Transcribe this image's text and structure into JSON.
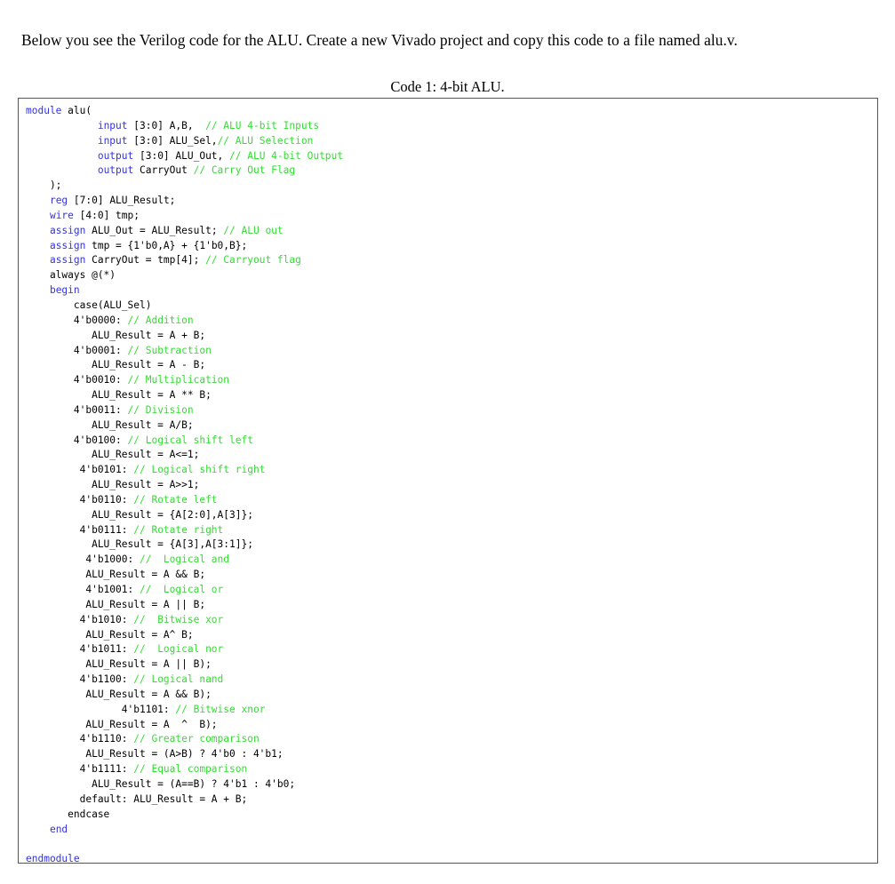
{
  "document": {
    "intro_paragraph": "Below you see the Verilog code for the ALU. Create a new Vivado project and copy this code to a file named alu.v.",
    "caption": "Code 1: 4-bit ALU."
  },
  "colors": {
    "keyword": "#3333dd",
    "comment": "#33dd33",
    "plain": "#000000",
    "box_border": "#555555",
    "background": "#ffffff"
  },
  "code": {
    "language": "verilog",
    "file_name": "alu.v",
    "lines": [
      [
        {
          "t": "module",
          "c": "kw"
        },
        {
          "t": " alu(",
          "c": "pln"
        }
      ],
      [
        {
          "t": "            ",
          "c": "pln"
        },
        {
          "t": "input",
          "c": "kw"
        },
        {
          "t": " [3:0] A,B,  ",
          "c": "pln"
        },
        {
          "t": "// ALU 4-bit Inputs",
          "c": "cmt"
        }
      ],
      [
        {
          "t": "            ",
          "c": "pln"
        },
        {
          "t": "input",
          "c": "kw"
        },
        {
          "t": " [3:0] ALU_Sel,",
          "c": "pln"
        },
        {
          "t": "// ALU Selection",
          "c": "cmt"
        }
      ],
      [
        {
          "t": "            ",
          "c": "pln"
        },
        {
          "t": "output",
          "c": "kw"
        },
        {
          "t": " [3:0] ALU_Out, ",
          "c": "pln"
        },
        {
          "t": "// ALU 4-bit Output",
          "c": "cmt"
        }
      ],
      [
        {
          "t": "            ",
          "c": "pln"
        },
        {
          "t": "output",
          "c": "kw"
        },
        {
          "t": " CarryOut ",
          "c": "pln"
        },
        {
          "t": "// Carry Out Flag",
          "c": "cmt"
        }
      ],
      [
        {
          "t": "    );",
          "c": "pln"
        }
      ],
      [
        {
          "t": "    ",
          "c": "pln"
        },
        {
          "t": "reg",
          "c": "kw"
        },
        {
          "t": " [7:0] ALU_Result;",
          "c": "pln"
        }
      ],
      [
        {
          "t": "    ",
          "c": "pln"
        },
        {
          "t": "wire",
          "c": "kw"
        },
        {
          "t": " [4:0] tmp;",
          "c": "pln"
        }
      ],
      [
        {
          "t": "    ",
          "c": "pln"
        },
        {
          "t": "assign",
          "c": "kw"
        },
        {
          "t": " ALU_Out = ALU_Result; ",
          "c": "pln"
        },
        {
          "t": "// ALU out",
          "c": "cmt"
        }
      ],
      [
        {
          "t": "    ",
          "c": "pln"
        },
        {
          "t": "assign",
          "c": "kw"
        },
        {
          "t": " tmp = {1'b0,A} + {1'b0,B};",
          "c": "pln"
        }
      ],
      [
        {
          "t": "    ",
          "c": "pln"
        },
        {
          "t": "assign",
          "c": "kw"
        },
        {
          "t": " CarryOut = tmp[4]; ",
          "c": "pln"
        },
        {
          "t": "// Carryout flag",
          "c": "cmt"
        }
      ],
      [
        {
          "t": "    always @(*)",
          "c": "pln"
        }
      ],
      [
        {
          "t": "    ",
          "c": "pln"
        },
        {
          "t": "begin",
          "c": "kw"
        }
      ],
      [
        {
          "t": "        case(ALU_Sel)",
          "c": "pln"
        }
      ],
      [
        {
          "t": "        4'b0000: ",
          "c": "pln"
        },
        {
          "t": "// Addition",
          "c": "cmt"
        }
      ],
      [
        {
          "t": "           ALU_Result = A + B;",
          "c": "pln"
        }
      ],
      [
        {
          "t": "        4'b0001: ",
          "c": "pln"
        },
        {
          "t": "// Subtraction",
          "c": "cmt"
        }
      ],
      [
        {
          "t": "           ALU_Result = A - B;",
          "c": "pln"
        }
      ],
      [
        {
          "t": "        4'b0010: ",
          "c": "pln"
        },
        {
          "t": "// Multiplication",
          "c": "cmt"
        }
      ],
      [
        {
          "t": "           ALU_Result = A ** B;",
          "c": "pln"
        }
      ],
      [
        {
          "t": "        4'b0011: ",
          "c": "pln"
        },
        {
          "t": "// Division",
          "c": "cmt"
        }
      ],
      [
        {
          "t": "           ALU_Result = A/B;",
          "c": "pln"
        }
      ],
      [
        {
          "t": "        4'b0100: ",
          "c": "pln"
        },
        {
          "t": "// Logical shift left",
          "c": "cmt"
        }
      ],
      [
        {
          "t": "           ALU_Result = A<=1;",
          "c": "pln"
        }
      ],
      [
        {
          "t": "         4'b0101: ",
          "c": "pln"
        },
        {
          "t": "// Logical shift right",
          "c": "cmt"
        }
      ],
      [
        {
          "t": "           ALU_Result = A>>1;",
          "c": "pln"
        }
      ],
      [
        {
          "t": "         4'b0110: ",
          "c": "pln"
        },
        {
          "t": "// Rotate left",
          "c": "cmt"
        }
      ],
      [
        {
          "t": "           ALU_Result = {A[2:0],A[3]};",
          "c": "pln"
        }
      ],
      [
        {
          "t": "         4'b0111: ",
          "c": "pln"
        },
        {
          "t": "// Rotate right",
          "c": "cmt"
        }
      ],
      [
        {
          "t": "           ALU_Result = {A[3],A[3:1]};",
          "c": "pln"
        }
      ],
      [
        {
          "t": "          4'b1000: ",
          "c": "pln"
        },
        {
          "t": "//  Logical and",
          "c": "cmt"
        }
      ],
      [
        {
          "t": "          ALU_Result = A && B;",
          "c": "pln"
        }
      ],
      [
        {
          "t": "          4'b1001: ",
          "c": "pln"
        },
        {
          "t": "//  Logical or",
          "c": "cmt"
        }
      ],
      [
        {
          "t": "          ALU_Result = A || B;",
          "c": "pln"
        }
      ],
      [
        {
          "t": "         4'b1010: ",
          "c": "pln"
        },
        {
          "t": "//  Bitwise xor",
          "c": "cmt"
        }
      ],
      [
        {
          "t": "          ALU_Result = A^ B;",
          "c": "pln"
        }
      ],
      [
        {
          "t": "         4'b1011: ",
          "c": "pln"
        },
        {
          "t": "//  Logical nor",
          "c": "cmt"
        }
      ],
      [
        {
          "t": "          ALU_Result = A || B);",
          "c": "pln"
        }
      ],
      [
        {
          "t": "         4'b1100: ",
          "c": "pln"
        },
        {
          "t": "// Logical nand",
          "c": "cmt"
        }
      ],
      [
        {
          "t": "          ALU_Result = A && B);",
          "c": "pln"
        }
      ],
      [
        {
          "t": "                4'b1101: ",
          "c": "pln"
        },
        {
          "t": "// Bitwise xnor",
          "c": "cmt"
        }
      ],
      [
        {
          "t": "          ALU_Result = A  ^  B);",
          "c": "pln"
        }
      ],
      [
        {
          "t": "         4'b1110: ",
          "c": "pln"
        },
        {
          "t": "// Greater comparison",
          "c": "cmt"
        }
      ],
      [
        {
          "t": "          ALU_Result = (A>B) ? 4'b0 : 4'b1;",
          "c": "pln"
        }
      ],
      [
        {
          "t": "         4'b1111: ",
          "c": "pln"
        },
        {
          "t": "// Equal comparison",
          "c": "cmt"
        }
      ],
      [
        {
          "t": "           ALU_Result = (A==B) ? 4'b1 : 4'b0;",
          "c": "pln"
        }
      ],
      [
        {
          "t": "         default: ALU_Result = A + B;",
          "c": "pln"
        }
      ],
      [
        {
          "t": "       endcase",
          "c": "pln"
        }
      ],
      [
        {
          "t": "    ",
          "c": "pln"
        },
        {
          "t": "end",
          "c": "kw"
        }
      ],
      [
        {
          "t": "",
          "c": "pln"
        }
      ],
      [
        {
          "t": "endmodule",
          "c": "kw"
        }
      ]
    ]
  }
}
